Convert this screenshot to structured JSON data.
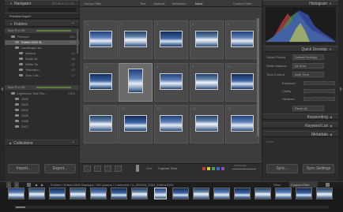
{
  "navigator": {
    "title": "Navigator",
    "zoom_opts": [
      "FIT",
      "FILL",
      "1:1",
      "3:1"
    ]
  },
  "preview": {
    "title": "Preview Import"
  },
  "folders": {
    "title": "Folders",
    "volume": "Mac Pro HD",
    "items": [
      {
        "label": "Pictures",
        "count": "892",
        "indent": 1
      },
      {
        "label": "Edited DNG B...",
        "count": "320",
        "indent": 2,
        "selected": true
      },
      {
        "label": "Landscape an...",
        "count": "",
        "indent": 2
      },
      {
        "label": "Iceland",
        "count": "42",
        "indent": 3
      },
      {
        "label": "South Af...",
        "count": "88",
        "indent": 3
      },
      {
        "label": "White Su...",
        "count": "52",
        "indent": 3
      },
      {
        "label": "Yellowsto...",
        "count": "42",
        "indent": 3
      },
      {
        "label": "Zion, Lak...",
        "count": "17",
        "indent": 3
      }
    ],
    "volume2": "Mac Pro HD",
    "items2": [
      {
        "label": "Lightroom Test Pho...",
        "count": "2808",
        "indent": 1
      },
      {
        "label": "2001",
        "count": "",
        "indent": 2
      },
      {
        "label": "2003",
        "count": "",
        "indent": 2
      },
      {
        "label": "2004",
        "count": "",
        "indent": 2
      },
      {
        "label": "2005",
        "count": "",
        "indent": 2
      },
      {
        "label": "2006",
        "count": "",
        "indent": 2
      },
      {
        "label": "2007",
        "count": "",
        "indent": 2
      }
    ]
  },
  "collections": {
    "title": "Collections"
  },
  "left_buttons": {
    "import": "Import...",
    "export": "Export..."
  },
  "filter_bar": {
    "title": "Library Filter :",
    "tabs": [
      "Text",
      "Attribute",
      "Metadata",
      "None"
    ],
    "active": "None",
    "preset": "Custom Filter"
  },
  "grid": {
    "numbers": [
      "1",
      "2",
      "3",
      "4",
      "5",
      "6",
      "7",
      "8",
      "9",
      "10",
      "11",
      "12",
      "13",
      "14",
      "15"
    ]
  },
  "toolbar": {
    "sort_label": "Sort:",
    "sort_value": "Capture Time",
    "colors": [
      "#c23b3b",
      "#d8c53a",
      "#48a048",
      "#3a6ad0",
      "#8a4bc2"
    ],
    "thumbs_label": "Thumbnails"
  },
  "histogram": {
    "title": "Histogram"
  },
  "quick_develop": {
    "title": "Quick Develop",
    "saved_preset": {
      "label": "Saved Preset",
      "value": "Default Settings"
    },
    "white_balance": {
      "label": "White Balance",
      "value": "As Shot"
    },
    "tone_control": {
      "label": "Tone Control",
      "value": "Auto Tone"
    },
    "rows": [
      "Exposure",
      "Clarity",
      "Vibrance"
    ],
    "reset": "Reset All"
  },
  "keywording": {
    "title": "Keywording"
  },
  "keyword_list": {
    "title": "Keyword List"
  },
  "metadata": {
    "title": "Metadata",
    "preset": "Default"
  },
  "right_buttons": {
    "sync": "Sync...",
    "sync_settings": "Sync Settings"
  },
  "filmstrip": {
    "pages": [
      "1",
      "2"
    ],
    "path": "Folders / Edited DNG Backups / 320 photos / 1 selected / IL_090118_2354_Edited.DNG",
    "filter_label": "Filter:",
    "filter_value": "Custom Filter"
  }
}
